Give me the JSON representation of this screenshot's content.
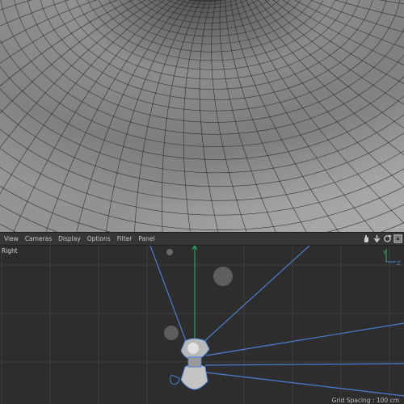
{
  "perspective": {
    "description_icon": "tunnel-mesh"
  },
  "toolbar": {
    "menus": [
      "View",
      "Cameras",
      "Display",
      "Options",
      "Filter",
      "Panel"
    ],
    "icons": [
      "move-view-icon",
      "dolly-view-icon",
      "rotate-view-icon",
      "maximize-view-icon"
    ]
  },
  "ortho": {
    "view_name": "Right",
    "grid_spacing": "Grid Spacing : 100 cm",
    "axis_y": "Y",
    "axis_z": "Z"
  },
  "colors": {
    "toolbar_bg": "#363636",
    "viewport_bg": "#2d2d2d",
    "camera_line": "#4a7fd0",
    "axis_green": "#2fb86a",
    "axis_blue": "#4a7fd0",
    "mesh": "#8a8a8a"
  }
}
